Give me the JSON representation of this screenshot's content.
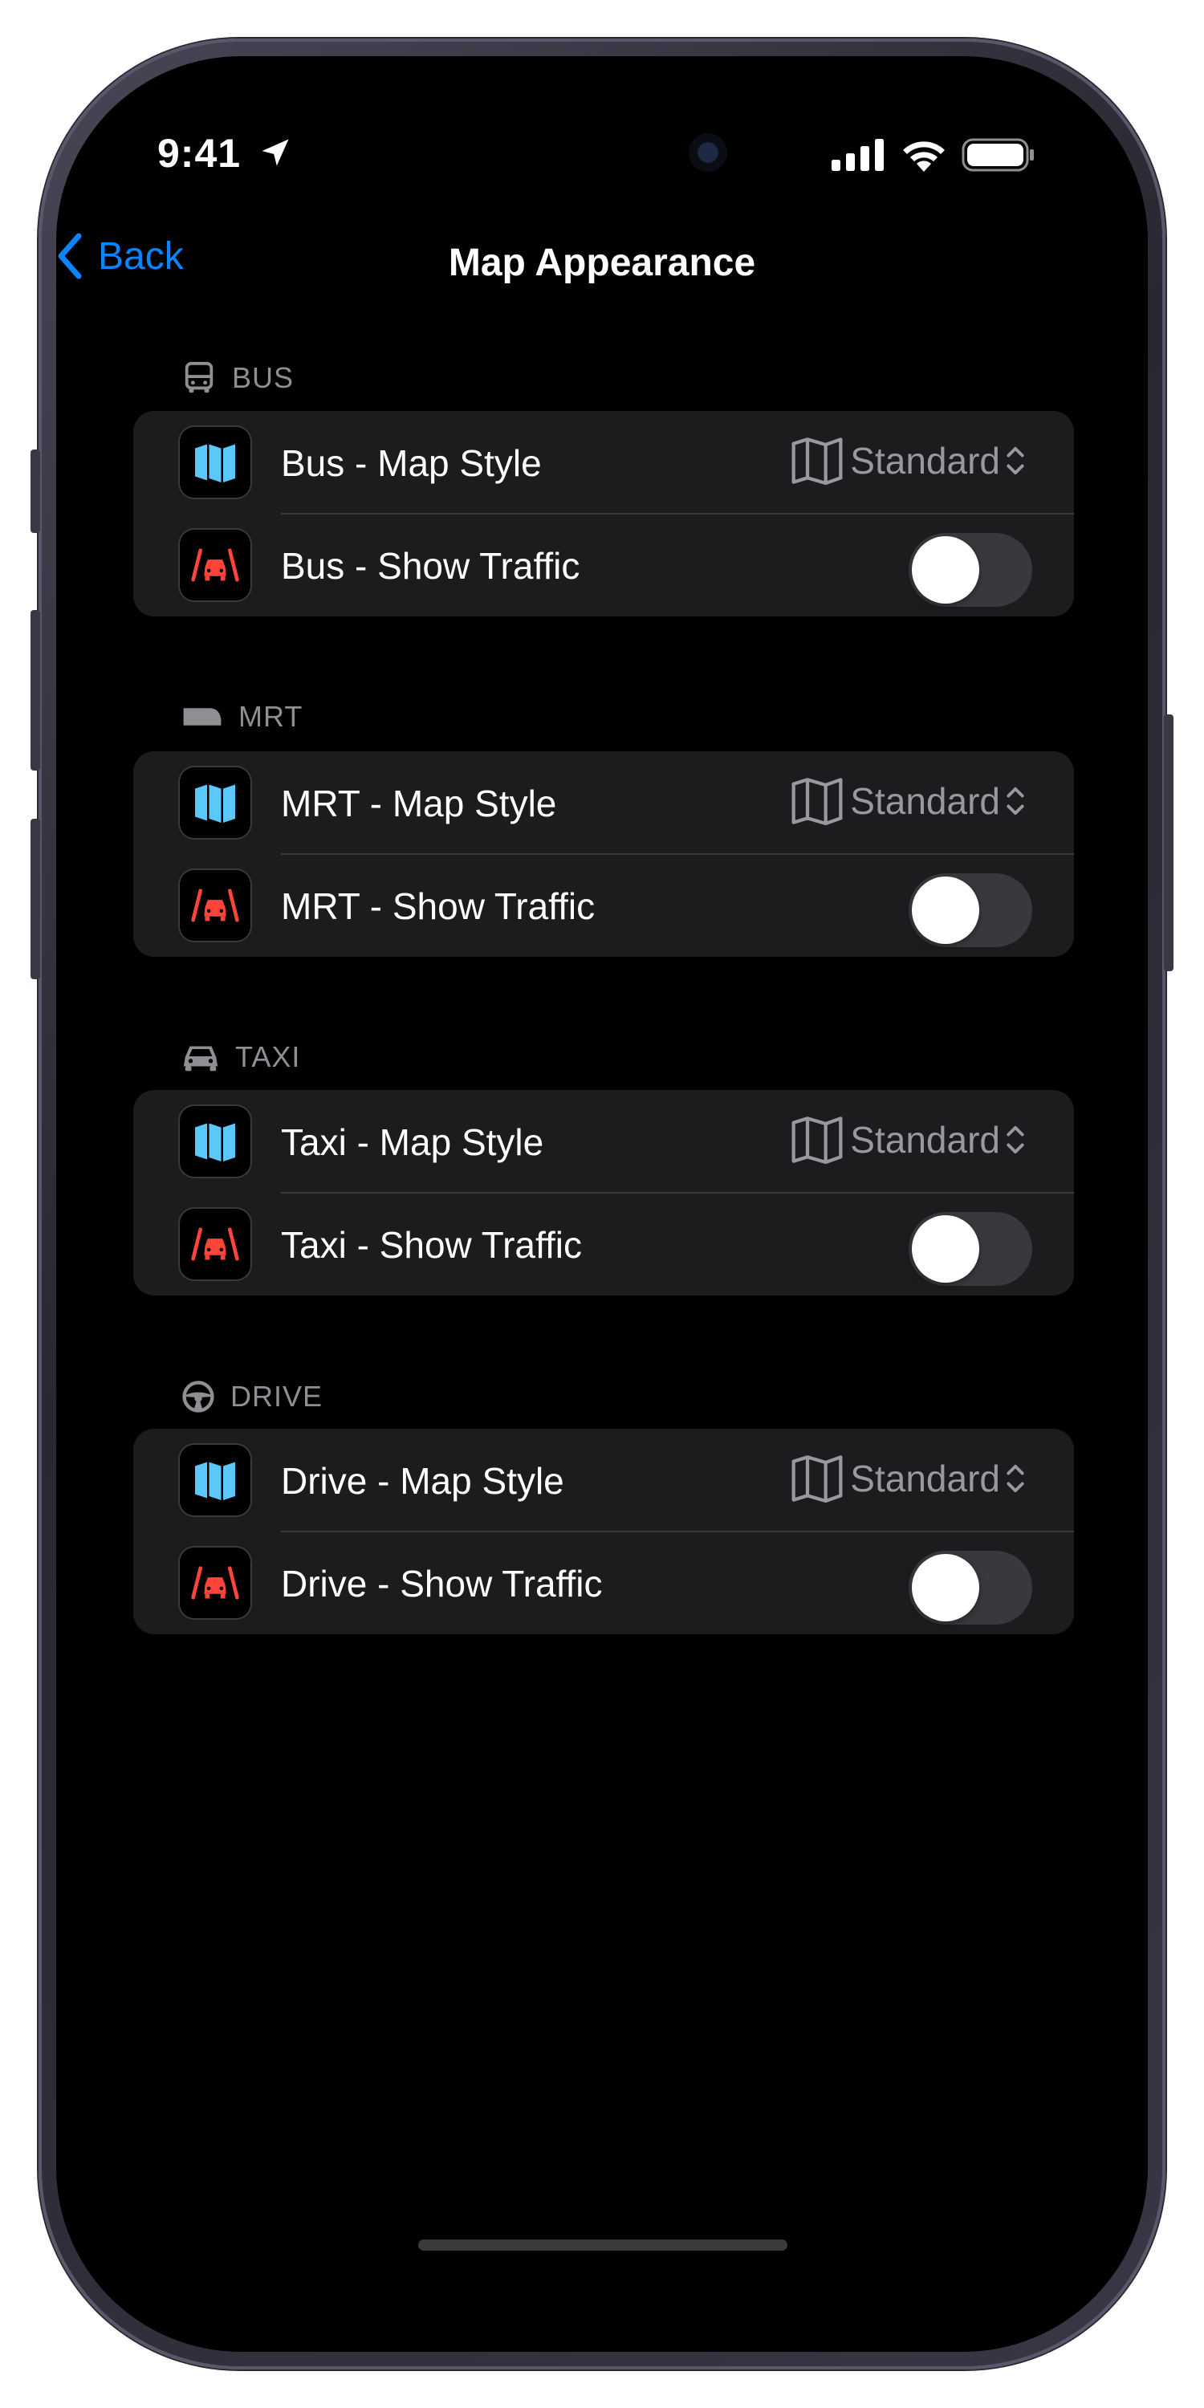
{
  "status_bar": {
    "time": "9:41"
  },
  "nav": {
    "back_label": "Back",
    "title": "Map Appearance"
  },
  "sections": [
    {
      "header": "BUS",
      "icon": "bus-icon",
      "map_style_label": "Bus - Map Style",
      "map_style_value": "Standard",
      "traffic_label": "Bus - Show Traffic",
      "traffic_on": false
    },
    {
      "header": "MRT",
      "icon": "train-icon",
      "map_style_label": "MRT - Map Style",
      "map_style_value": "Standard",
      "traffic_label": "MRT - Show Traffic",
      "traffic_on": false
    },
    {
      "header": "TAXI",
      "icon": "car-icon",
      "map_style_label": "Taxi - Map Style",
      "map_style_value": "Standard",
      "traffic_label": "Taxi - Show Traffic",
      "traffic_on": false
    },
    {
      "header": "DRIVE",
      "icon": "steering-wheel-icon",
      "map_style_label": "Drive - Map Style",
      "map_style_value": "Standard",
      "traffic_label": "Drive - Show Traffic",
      "traffic_on": false
    }
  ],
  "colors": {
    "accent": "#0a84ff",
    "background": "#000000",
    "group_background": "#1c1c1e",
    "secondary_text": "#8e8e93",
    "map_icon": "#5ac8fa",
    "traffic_icon": "#ff453a"
  }
}
